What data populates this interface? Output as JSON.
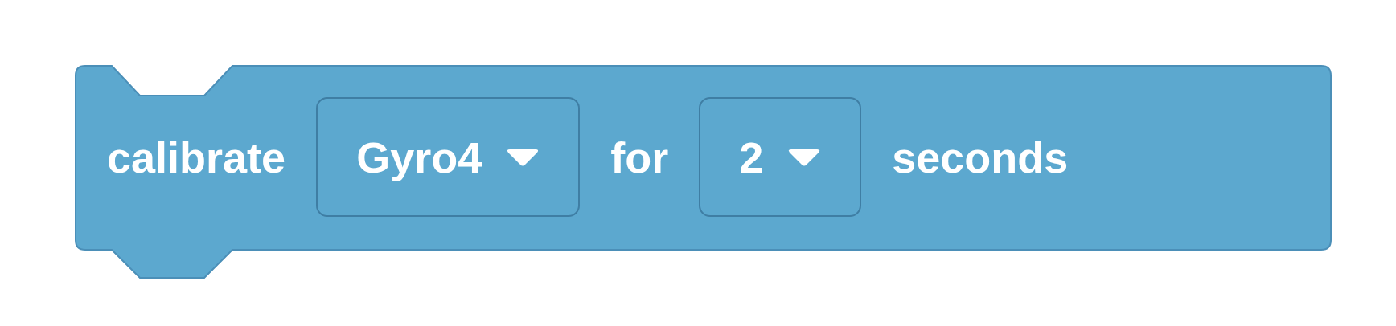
{
  "block": {
    "parts": [
      {
        "kind": "text",
        "text": "calibrate"
      },
      {
        "kind": "dropdown",
        "value": "Gyro4"
      },
      {
        "kind": "text",
        "text": "for"
      },
      {
        "kind": "dropdown",
        "value": "2"
      },
      {
        "kind": "text",
        "text": "seconds"
      }
    ]
  }
}
